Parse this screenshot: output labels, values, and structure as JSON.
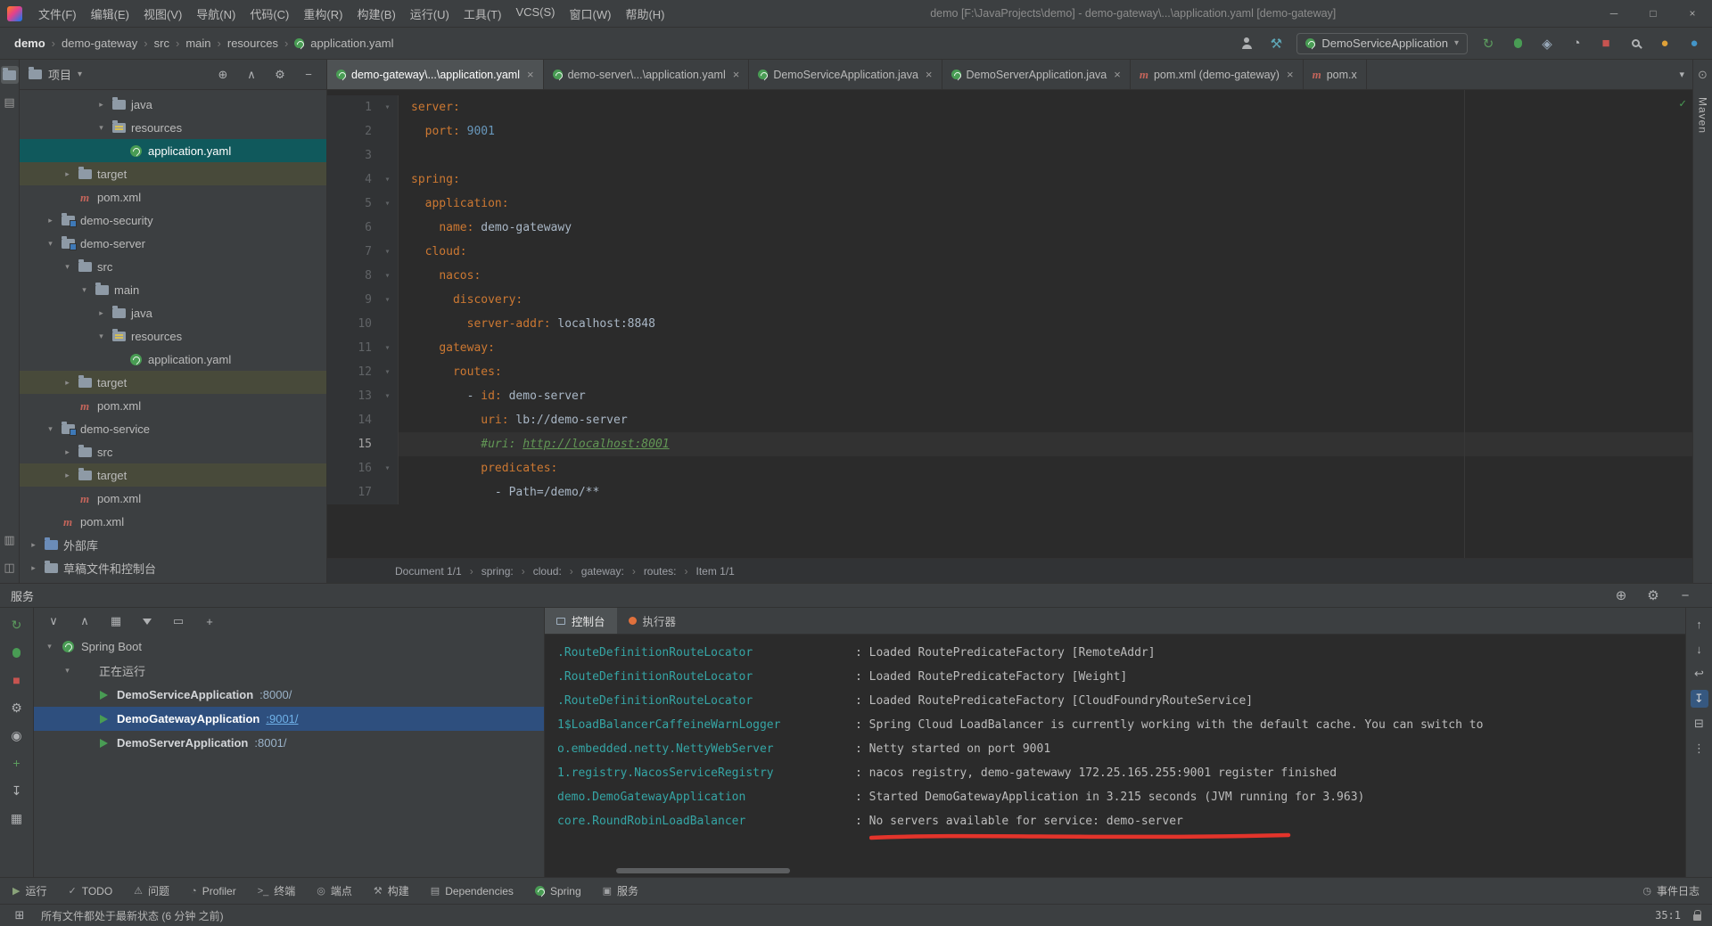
{
  "colors": {
    "accent_green": "#499C54",
    "accent_red": "#C75450",
    "key_orange": "#CC7832",
    "value_blue": "#6897BB",
    "comment_green": "#629755",
    "logger_teal": "#35A5A5",
    "marker_red": "#E3342B",
    "selection_teal": "#10595C",
    "selection_blue": "#2E4F7E"
  },
  "title_bar": {
    "menus": [
      "文件(F)",
      "编辑(E)",
      "视图(V)",
      "导航(N)",
      "代码(C)",
      "重构(R)",
      "构建(B)",
      "运行(U)",
      "工具(T)",
      "VCS(S)",
      "窗口(W)",
      "帮助(H)"
    ],
    "title": "demo [F:\\JavaProjects\\demo] - demo-gateway\\...\\application.yaml [demo-gateway]",
    "window_buttons": [
      {
        "name": "minimize-button",
        "glyph": "─"
      },
      {
        "name": "maximize-button",
        "glyph": "□"
      },
      {
        "name": "close-button",
        "glyph": "×"
      }
    ]
  },
  "nav_bar": {
    "breadcrumbs": [
      "demo",
      "demo-gateway",
      "src",
      "main",
      "resources",
      "application.yaml"
    ],
    "icons_left": [
      {
        "name": "user-settings-icon",
        "css": "i-person"
      },
      {
        "name": "build-hammer-icon",
        "glyph": "⚒",
        "color": "#5FA8B8"
      }
    ],
    "run_config": "DemoServiceApplication",
    "icons_right": [
      {
        "name": "rerun-icon",
        "glyph": "↻",
        "color": "#5C9C5E"
      },
      {
        "name": "debug-icon",
        "css": "i-bug"
      },
      {
        "name": "coverage-icon",
        "glyph": "◈",
        "color": "#98A8B8"
      },
      {
        "name": "profiler-icon",
        "glyph": "◔",
        "color": "#AFB1B3"
      },
      {
        "name": "stop-icon",
        "glyph": "■",
        "color": "#C75450"
      },
      {
        "name": "search-everywhere-icon",
        "css": "i-search"
      },
      {
        "name": "updates-icon",
        "glyph": "●",
        "color": "#DFA138"
      },
      {
        "name": "code-with-me-icon",
        "glyph": "●",
        "color": "#4395C8"
      }
    ]
  },
  "left_stripe": {
    "top": [
      {
        "name": "project-stripe-button",
        "css": "i-folder",
        "active": true
      },
      {
        "name": "bookmarks-stripe-button",
        "glyph": "▤"
      }
    ],
    "bottom": [
      {
        "name": "toolwindow-stripe-button-1",
        "glyph": "▥"
      },
      {
        "name": "toolwindow-stripe-button-2",
        "glyph": "◫"
      }
    ]
  },
  "right_stripe": {
    "top_icon": {
      "name": "notifications-icon",
      "glyph": "⊙"
    },
    "label": "Maven"
  },
  "project_panel": {
    "title": "项目",
    "title_dropdown_glyph": "▾",
    "header_icons": [
      {
        "name": "locate-file-icon",
        "glyph": "⊕"
      },
      {
        "name": "collapse-all-icon",
        "glyph": "∧"
      },
      {
        "name": "settings-gear-icon",
        "glyph": "⚙"
      },
      {
        "name": "hide-panel-icon",
        "glyph": "−"
      }
    ],
    "tree": [
      {
        "label": "java",
        "level": 4,
        "chevron": ">",
        "icon": "folder"
      },
      {
        "label": "resources",
        "level": 4,
        "chevron": "v",
        "icon": "folder-resources"
      },
      {
        "label": "application.yaml",
        "level": 5,
        "icon": "spring",
        "selected": true
      },
      {
        "label": "target",
        "level": 2,
        "chevron": ">",
        "icon": "folder",
        "excluded": true
      },
      {
        "label": "pom.xml",
        "level": 2,
        "icon": "maven"
      },
      {
        "label": "demo-security",
        "level": 1,
        "chevron": ">",
        "icon": "module"
      },
      {
        "label": "demo-server",
        "level": 1,
        "chevron": "v",
        "icon": "module"
      },
      {
        "label": "src",
        "level": 2,
        "chevron": "v",
        "icon": "folder"
      },
      {
        "label": "main",
        "level": 3,
        "chevron": "v",
        "icon": "folder"
      },
      {
        "label": "java",
        "level": 4,
        "chevron": ">",
        "icon": "folder"
      },
      {
        "label": "resources",
        "level": 4,
        "chevron": "v",
        "icon": "folder-resources"
      },
      {
        "label": "application.yaml",
        "level": 5,
        "icon": "spring"
      },
      {
        "label": "target",
        "level": 2,
        "chevron": ">",
        "icon": "folder",
        "excluded": true
      },
      {
        "label": "pom.xml",
        "level": 2,
        "icon": "maven"
      },
      {
        "label": "demo-service",
        "level": 1,
        "chevron": "v",
        "icon": "module"
      },
      {
        "label": "src",
        "level": 2,
        "chevron": ">",
        "icon": "folder"
      },
      {
        "label": "target",
        "level": 2,
        "chevron": ">",
        "icon": "folder",
        "excluded": true
      },
      {
        "label": "pom.xml",
        "level": 2,
        "icon": "maven"
      },
      {
        "label": "pom.xml",
        "level": 1,
        "icon": "maven"
      },
      {
        "label": "外部库",
        "level": 0,
        "chevron": ">",
        "icon": "libraries"
      },
      {
        "label": "草稿文件和控制台",
        "level": 0,
        "chevron": ">",
        "icon": "folder"
      }
    ]
  },
  "editor": {
    "tabs": [
      {
        "label": "demo-gateway\\...\\application.yaml",
        "icon": "spring",
        "active": true
      },
      {
        "label": "demo-server\\...\\application.yaml",
        "icon": "spring"
      },
      {
        "label": "DemoServiceApplication.java",
        "icon": "spring-boot"
      },
      {
        "label": "DemoServerApplication.java",
        "icon": "spring-boot"
      },
      {
        "label": "pom.xml (demo-gateway)",
        "icon": "maven"
      },
      {
        "label": "pom.x",
        "icon": "maven",
        "cut": true
      }
    ],
    "hidden_tabs_glyph": "▾",
    "code": [
      {
        "num": 1,
        "fold": true,
        "segments": [
          {
            "t": "server:",
            "c": "key"
          }
        ]
      },
      {
        "num": 2,
        "segments": [
          {
            "t": "  "
          },
          {
            "t": "port:",
            "c": "key"
          },
          {
            "t": " "
          },
          {
            "t": "9001",
            "c": "num"
          }
        ]
      },
      {
        "num": 3,
        "segments": []
      },
      {
        "num": 4,
        "fold": true,
        "segments": [
          {
            "t": "spring:",
            "c": "key"
          }
        ]
      },
      {
        "num": 5,
        "fold": true,
        "segments": [
          {
            "t": "  "
          },
          {
            "t": "application:",
            "c": "key"
          }
        ]
      },
      {
        "num": 6,
        "segments": [
          {
            "t": "    "
          },
          {
            "t": "name:",
            "c": "key"
          },
          {
            "t": " demo-gatewawy"
          }
        ]
      },
      {
        "num": 7,
        "fold": true,
        "segments": [
          {
            "t": "  "
          },
          {
            "t": "cloud:",
            "c": "key"
          }
        ]
      },
      {
        "num": 8,
        "fold": true,
        "segments": [
          {
            "t": "    "
          },
          {
            "t": "nacos:",
            "c": "key"
          }
        ]
      },
      {
        "num": 9,
        "fold": true,
        "segments": [
          {
            "t": "      "
          },
          {
            "t": "discovery:",
            "c": "key"
          }
        ]
      },
      {
        "num": 10,
        "segments": [
          {
            "t": "        "
          },
          {
            "t": "server-addr:",
            "c": "key"
          },
          {
            "t": " localhost:8848"
          }
        ]
      },
      {
        "num": 11,
        "fold": true,
        "segments": [
          {
            "t": "    "
          },
          {
            "t": "gateway:",
            "c": "key"
          }
        ]
      },
      {
        "num": 12,
        "fold": true,
        "segments": [
          {
            "t": "      "
          },
          {
            "t": "routes:",
            "c": "key"
          }
        ]
      },
      {
        "num": 13,
        "fold": true,
        "segments": [
          {
            "t": "        - "
          },
          {
            "t": "id:",
            "c": "key"
          },
          {
            "t": " demo-server"
          }
        ]
      },
      {
        "num": 14,
        "segments": [
          {
            "t": "          "
          },
          {
            "t": "uri:",
            "c": "key"
          },
          {
            "t": " lb://demo-server"
          }
        ]
      },
      {
        "num": 15,
        "current": true,
        "segments": [
          {
            "t": "          "
          },
          {
            "t": "#uri: ",
            "c": "comment"
          },
          {
            "t": "http://localhost:8001",
            "c": "clink"
          }
        ]
      },
      {
        "num": 16,
        "fold": true,
        "segments": [
          {
            "t": "          "
          },
          {
            "t": "predicates:",
            "c": "key"
          }
        ]
      },
      {
        "num": 17,
        "segments": [
          {
            "t": "            - Path=/demo/**"
          }
        ]
      }
    ],
    "breadcrumbs": [
      "Document 1/1",
      "spring:",
      "cloud:",
      "gateway:",
      "routes:",
      "Item 1/1"
    ]
  },
  "services_panel": {
    "title": "服务",
    "header_icons": [
      {
        "name": "browser-icon",
        "glyph": "⊕"
      },
      {
        "name": "settings-gear-icon",
        "glyph": "⚙"
      },
      {
        "name": "hide-panel-icon",
        "glyph": "−"
      }
    ],
    "toolbar_icons": [
      {
        "name": "expand-all-icon",
        "glyph": "∨"
      },
      {
        "name": "collapse-all-icon",
        "glyph": "∧"
      },
      {
        "name": "group-by-icon",
        "glyph": "▦"
      },
      {
        "name": "filter-icon",
        "css": "i-funnel"
      },
      {
        "name": "frame-icon",
        "glyph": "▭"
      },
      {
        "name": "add-service-icon",
        "glyph": "+"
      }
    ],
    "side_icons": [
      {
        "name": "rerun-icon",
        "glyph": "↻",
        "color": "#5C9C5E"
      },
      {
        "name": "debug-icon",
        "css": "i-bug"
      },
      {
        "name": "stop-icon",
        "glyph": "■",
        "color": "#C75450"
      },
      {
        "name": "wrench-icon",
        "glyph": "⚙",
        "color": "#AFB1B3"
      },
      {
        "name": "thread-dump-icon",
        "glyph": "◉",
        "color": "#AFB1B3"
      },
      {
        "name": "add-icon",
        "glyph": "+",
        "color": "#5C9C5E"
      },
      {
        "name": "scroll-to-icon",
        "glyph": "↧",
        "color": "#AFB1B3"
      },
      {
        "name": "grid-icon",
        "glyph": "▦",
        "color": "#AFB1B3"
      }
    ],
    "tree": [
      {
        "label": "Spring Boot",
        "level": 0,
        "chevron": "v",
        "icon": "spring"
      },
      {
        "label": "正在运行",
        "level": 1,
        "chevron": "v",
        "icon": "none"
      },
      {
        "label": "DemoServiceApplication",
        "port": ":8000/",
        "level": 2,
        "icon": "run"
      },
      {
        "label": "DemoGatewayApplication",
        "port": ":9001/",
        "level": 2,
        "icon": "run",
        "selected": true
      },
      {
        "label": "DemoServerApplication",
        "port": ":8001/",
        "level": 2,
        "icon": "run"
      }
    ],
    "console_tabs": [
      "控制台",
      "执行器"
    ],
    "console_lines": [
      {
        "logger": ".RouteDefinitionRouteLocator",
        "message": ": Loaded RoutePredicateFactory [RemoteAddr]"
      },
      {
        "logger": ".RouteDefinitionRouteLocator",
        "message": ": Loaded RoutePredicateFactory [Weight]"
      },
      {
        "logger": ".RouteDefinitionRouteLocator",
        "message": ": Loaded RoutePredicateFactory [CloudFoundryRouteService]"
      },
      {
        "logger": "1$LoadBalancerCaffeineWarnLogger",
        "message": ": Spring Cloud LoadBalancer is currently working with the default cache. You can switch to"
      },
      {
        "logger": "o.embedded.netty.NettyWebServer",
        "message": ": Netty started on port 9001"
      },
      {
        "logger": "1.registry.NacosServiceRegistry",
        "message": ": nacos registry, demo-gatewawy 172.25.165.255:9001 register finished"
      },
      {
        "logger": "demo.DemoGatewayApplication",
        "message": ": Started DemoGatewayApplication in 3.215 seconds (JVM running for 3.963)"
      },
      {
        "logger": "core.RoundRobinLoadBalancer",
        "message": ": No servers available for service: demo-server",
        "marked": true
      }
    ],
    "console_icons": [
      {
        "name": "scroll-up-icon",
        "glyph": "↑"
      },
      {
        "name": "scroll-down-icon",
        "glyph": "↓"
      },
      {
        "name": "soft-wrap-icon",
        "glyph": "↩"
      },
      {
        "name": "scroll-to-end-icon",
        "glyph": "↧",
        "toggled": true
      },
      {
        "name": "clear-console-icon",
        "glyph": "⊟"
      },
      {
        "name": "more-options-icon",
        "glyph": "⋮"
      }
    ]
  },
  "bottom_bar": {
    "left_items": [
      {
        "label": "运行",
        "icon": {
          "name": "run-icon",
          "glyph": "▶",
          "color": "#8aa37a"
        }
      },
      {
        "label": "TODO",
        "icon": {
          "name": "todo-icon",
          "glyph": "✓",
          "color": "#9fa1a3"
        }
      },
      {
        "label": "问题",
        "icon": {
          "name": "problems-icon",
          "glyph": "⚠",
          "color": "#9fa1a3"
        }
      },
      {
        "label": "Profiler",
        "icon": {
          "name": "profiler-icon",
          "glyph": "◔",
          "color": "#9fa1a3"
        }
      },
      {
        "label": "终端",
        "icon": {
          "name": "terminal-icon",
          "glyph": ">_",
          "color": "#9fa1a3"
        }
      },
      {
        "label": "端点",
        "icon": {
          "name": "endpoints-icon",
          "glyph": "◎",
          "color": "#9fa1a3"
        }
      },
      {
        "label": "构建",
        "icon": {
          "name": "build-icon",
          "glyph": "⚒",
          "color": "#9fa1a3"
        }
      },
      {
        "label": "Dependencies",
        "icon": {
          "name": "dependencies-icon",
          "glyph": "▤",
          "color": "#9fa1a3"
        }
      },
      {
        "label": "Spring",
        "icon": {
          "name": "spring-icon",
          "css": "i-spring sm"
        }
      },
      {
        "label": "服务",
        "icon": {
          "name": "services-icon",
          "glyph": "▣",
          "color": "#9fa1a3"
        }
      }
    ],
    "right_items": [
      {
        "label": "事件日志",
        "icon": {
          "name": "event-log-icon",
          "glyph": "◷",
          "color": "#9fa1a3"
        }
      }
    ]
  },
  "status_bar": {
    "switcher_glyph": "⊞",
    "message": "所有文件都处于最新状态 (6 分钟 之前)",
    "caret": "35:1"
  }
}
